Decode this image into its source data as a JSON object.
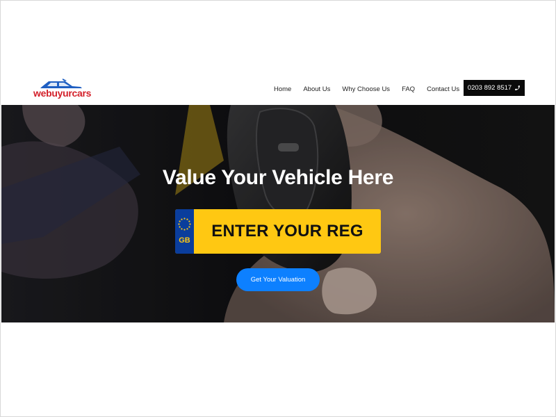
{
  "brand": {
    "logo_text": "webuyurcars",
    "colors": {
      "text": "#d3202a",
      "roof": "#1f5fc2"
    }
  },
  "nav": {
    "items": [
      {
        "label": "Home"
      },
      {
        "label": "About Us"
      },
      {
        "label": "Why Choose Us"
      },
      {
        "label": "FAQ"
      },
      {
        "label": "Contact Us"
      }
    ],
    "phone_label": "0203 892 8517",
    "phone_icon": "phone-icon"
  },
  "hero": {
    "title": "Value Your Vehicle Here",
    "plate": {
      "country_code": "GB",
      "placeholder": "ENTER YOUR REG",
      "badge_icon": "eu-stars-icon",
      "colors": {
        "plate": "#ffc812",
        "badge": "#0a3d9c"
      }
    },
    "cta_label": "Get Your Valuation",
    "cta_color": "#0d80ff"
  }
}
